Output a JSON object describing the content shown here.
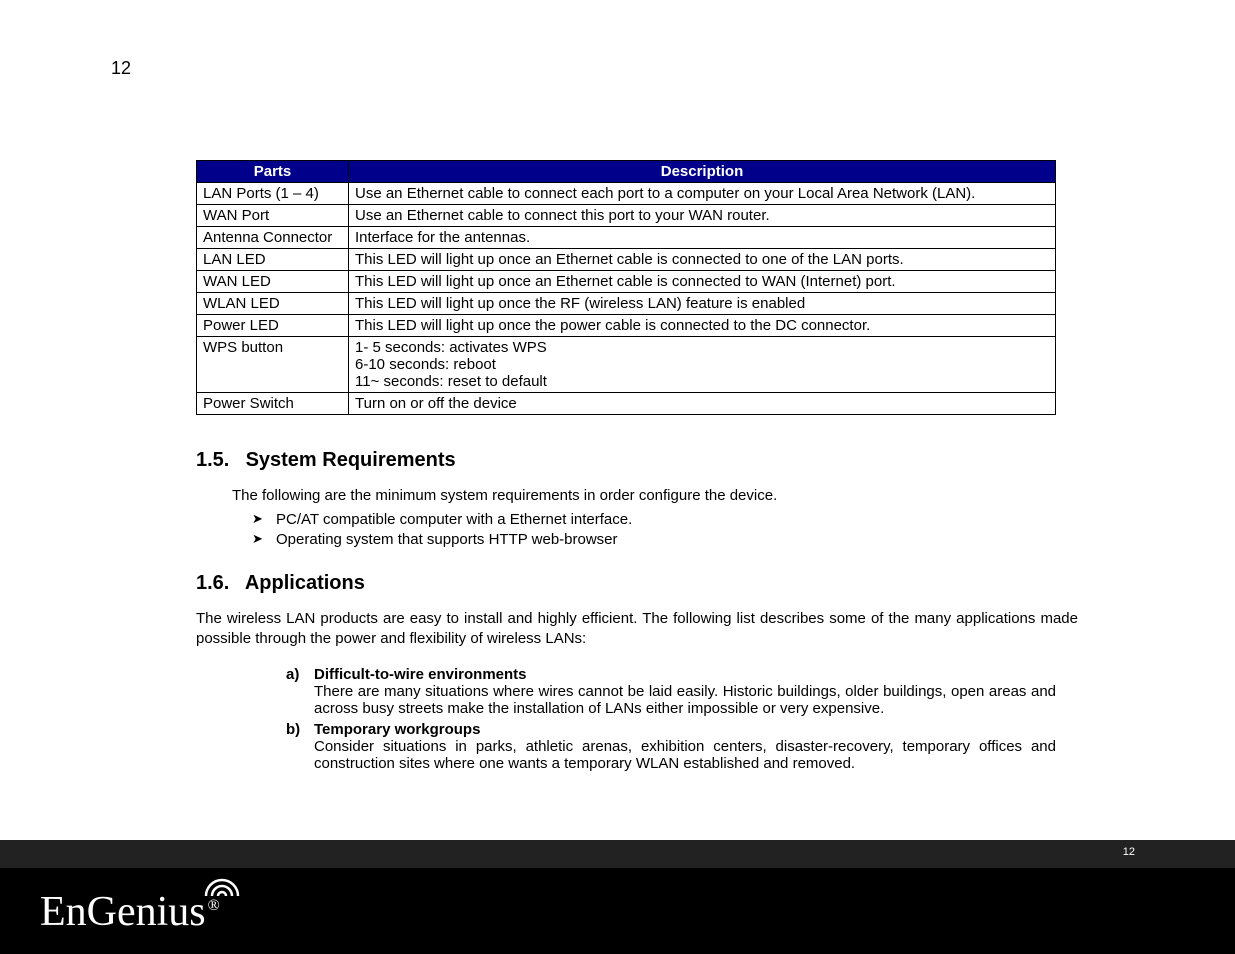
{
  "pageNumberTop": "12",
  "table": {
    "headers": {
      "parts": "Parts",
      "description": "Description"
    },
    "rows": [
      {
        "part": "LAN Ports (1 – 4)",
        "desc": "Use an Ethernet cable to connect each port to a computer on your Local Area Network (LAN).",
        "pad": false
      },
      {
        "part": "WAN Port",
        "desc": "Use an Ethernet cable to connect this port to your WAN router.",
        "pad": false
      },
      {
        "part": "Antenna Connector",
        "desc": "Interface for the antennas.",
        "pad": true
      },
      {
        "part": "LAN LED",
        "desc": "This LED will light up once an Ethernet cable is connected to one of the LAN ports.",
        "pad": false
      },
      {
        "part": "WAN LED",
        "desc": "This LED will light up once an Ethernet cable is connected to WAN (Internet) port.",
        "pad": false
      },
      {
        "part": "WLAN LED",
        "desc": "This LED will light up once the RF (wireless LAN) feature is enabled",
        "pad": false
      },
      {
        "part": "Power LED",
        "desc": "This LED will light up once the power cable is connected to the DC connector.",
        "pad": false
      },
      {
        "part": "WPS button",
        "desc": "1- 5  seconds: activates WPS\n6-10 seconds: reboot\n11~  seconds: reset to default",
        "pad": false
      },
      {
        "part": "Power Switch",
        "desc": "Turn on or off the device",
        "pad": true
      }
    ]
  },
  "sections": {
    "sysreq": {
      "num": "1.5.",
      "title": "System Requirements",
      "intro": "The following are the minimum system requirements in order configure the device.",
      "bullets": [
        "PC/AT compatible computer with a Ethernet interface.",
        "Operating system that supports HTTP web-browser"
      ]
    },
    "apps": {
      "num": "1.6.",
      "title": "Applications",
      "intro": "The wireless LAN products are easy to install and highly efficient. The following list describes some of the many applications made possible through the power and flexibility of wireless LANs:",
      "items": [
        {
          "letter": "a)",
          "title": "Difficult-to-wire environments",
          "desc": "There are many situations where wires cannot be laid easily. Historic buildings, older buildings, open areas and across busy streets make the installation of LANs either impossible or very expensive."
        },
        {
          "letter": "b)",
          "title": "Temporary workgroups",
          "desc": "Consider situations in parks, athletic arenas, exhibition centers, disaster-recovery, temporary offices and construction sites where one wants a temporary WLAN established and removed."
        }
      ]
    }
  },
  "footer": {
    "pageNumber": "12",
    "logoText": "EnGenius",
    "registered": "®"
  }
}
